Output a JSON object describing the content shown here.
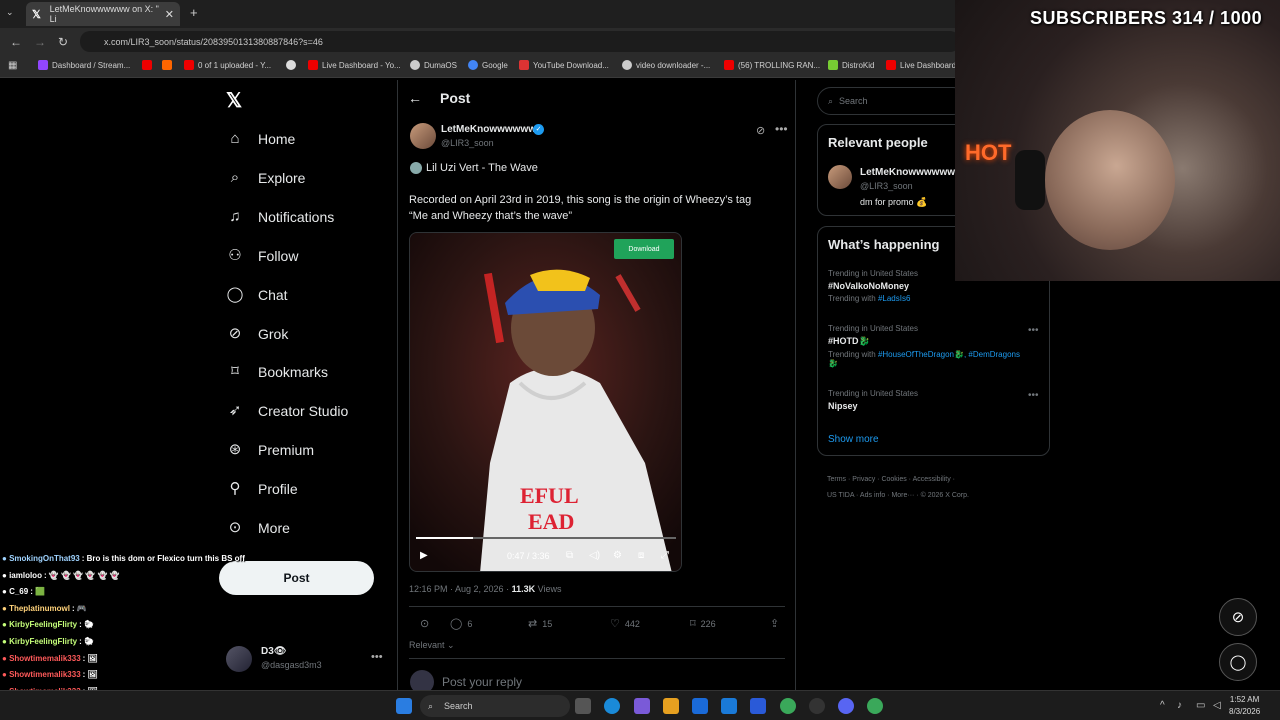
{
  "browser": {
    "tab_title": "LetMeKnowwwwww on X: \" Li",
    "url": "x.com/LIR3_soon/status/2083950131380887846?s=46",
    "bookmarks": [
      "Dashboard / Stream...",
      "0 of 1 uploaded - Y...",
      "Live Dashboard - Yo...",
      "DumaOS",
      "Google",
      "YouTube Download...",
      "video downloader -...",
      "(56) TROLLING RAN...",
      "DistroKid",
      "Live Dashboard"
    ]
  },
  "nav": {
    "items": [
      "Home",
      "Explore",
      "Notifications",
      "Follow",
      "Chat",
      "Grok",
      "Bookmarks",
      "Creator Studio",
      "Premium",
      "Profile",
      "More"
    ],
    "post_button": "Post"
  },
  "post": {
    "header": "Post",
    "author_name": "LetMeKnowwwwww",
    "author_handle": "@LIR3_soon",
    "song": "Lil Uzi Vert - The Wave",
    "body_line1": "Recorded on April 23rd in 2019, this song is the origin of Wheezy’s tag",
    "body_line2": "“Me and Wheezy that’s the wave”",
    "download_label": "Download",
    "video_time": "0:47 / 3:36",
    "progress": 0.22,
    "timestamp": "12:16 PM · Aug 2, 2026 · ",
    "views_count": "11.3K",
    "views_label": " Views",
    "replies": "6",
    "reposts": "15",
    "likes": "442",
    "bookmarks": "226",
    "relevant": "Relevant",
    "reply_placeholder": "Post your reply"
  },
  "sidebar": {
    "search_placeholder": "Search",
    "relevant_title": "Relevant people",
    "rel_name": "LetMeKnowwwwww",
    "rel_handle": "@LIR3_soon",
    "rel_bio": "dm for promo 💰",
    "happening_title": "What’s happening",
    "trends": [
      {
        "context": "Trending in United States",
        "title": "#NoValkoNoMoney",
        "with": "Trending with ",
        "tags": "#LadsIs6"
      },
      {
        "context": "Trending in United States",
        "title": "#HOTD🐉",
        "with": "Trending with ",
        "tags": "#HouseOfTheDragon🐉, #DemDragons🐉"
      },
      {
        "context": "Trending in United States",
        "title": "Nipsey",
        "with": "",
        "tags": ""
      }
    ],
    "show_more": "Show more",
    "footer_line1": "Terms · Privacy · Cookies · Accessibility ·",
    "footer_line2": "US TIDA · Ads info · More··· · © 2026 X Corp."
  },
  "user": {
    "name": "D3👁",
    "handle": "@dasgasd3m3"
  },
  "stream": {
    "subscribers": "SUBSCRIBERS 314 / 1000",
    "neon": "HOT"
  },
  "chat": [
    {
      "name": "SmokingOnThat93",
      "msg": ": Bro is this dom or Flexico turn this BS off",
      "color": "#9fd3ff"
    },
    {
      "name": "iamloloo",
      "msg": ": 👻 👻 👻 👻 👻 👻",
      "color": "#ffffff"
    },
    {
      "name": "C_69",
      "msg": ": 🟩",
      "color": "#ffffff"
    },
    {
      "name": "Theplatinumowl",
      "msg": ": 🎮",
      "color": "#ffd27a"
    },
    {
      "name": "KirbyFeelingFlirty",
      "msg": ": 🐑",
      "color": "#c6ff7a"
    },
    {
      "name": "KirbyFeelingFlirty",
      "msg": ": 🐑",
      "color": "#c6ff7a"
    },
    {
      "name": "Showtimemalik333",
      "msg": ": 🖼",
      "color": "#ff5a5a"
    },
    {
      "name": "Showtimemalik333",
      "msg": ": 🖼",
      "color": "#ff5a5a"
    },
    {
      "name": "Showtimemalik333",
      "msg": ": 🖼",
      "color": "#ff5a5a"
    },
    {
      "name": "Showtimemalik333",
      "msg": ": 🖼",
      "color": "#ff5a5a"
    }
  ],
  "taskbar": {
    "search": "Search",
    "time": "1:52 AM",
    "date": "8/3/2026"
  }
}
